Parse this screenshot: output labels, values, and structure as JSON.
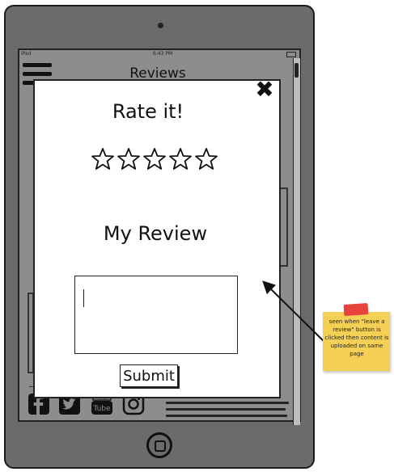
{
  "device": {
    "status_bar": {
      "carrier": "iPad",
      "time": "6:43 PM"
    }
  },
  "background": {
    "title": "Reviews",
    "social_icons": [
      "facebook-icon",
      "twitter-icon",
      "youtube-icon",
      "instagram-icon"
    ]
  },
  "modal": {
    "rate_title": "Rate it!",
    "star_count": 5,
    "review_title": "My Review",
    "review_value": "",
    "submit_label": "Submit",
    "close_icon": "close-icon"
  },
  "annotation": {
    "note": "seen when \"leave a review\" button is clicked then content is uploaded on same page",
    "colors": {
      "note": "#f5d054",
      "pin": "#e8423c"
    }
  }
}
